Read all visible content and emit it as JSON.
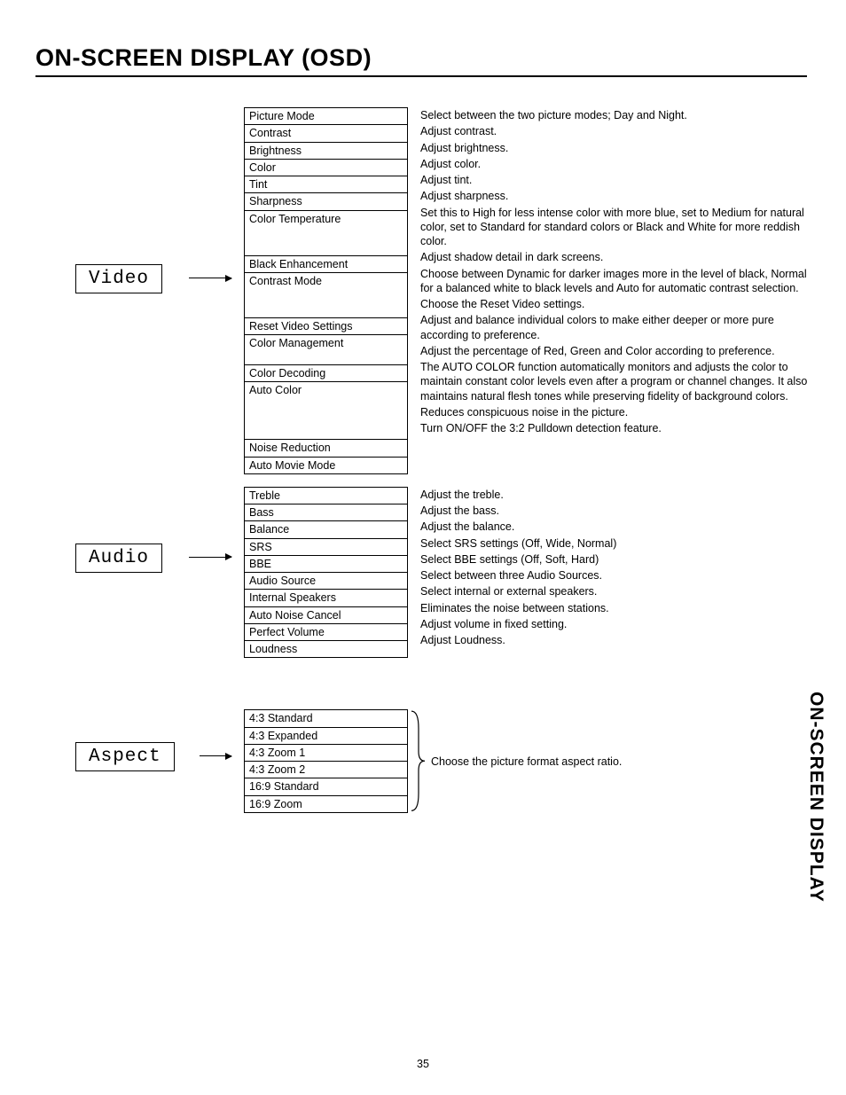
{
  "title": "ON-SCREEN DISPLAY (OSD)",
  "page_number": "35",
  "side_tab": "ON-SCREEN DISPLAY",
  "sections": {
    "video": {
      "label": "Video",
      "items": [
        {
          "name": "Picture Mode",
          "desc": "Select between the two picture modes; Day and Night."
        },
        {
          "name": "Contrast",
          "desc": "Adjust contrast."
        },
        {
          "name": "Brightness",
          "desc": "Adjust brightness."
        },
        {
          "name": "Color",
          "desc": "Adjust color."
        },
        {
          "name": "Tint",
          "desc": "Adjust tint."
        },
        {
          "name": "Sharpness",
          "desc": "Adjust sharpness."
        },
        {
          "name": "Color Temperature",
          "desc": "Set this to High for less intense color with more blue, set to Medium for natural color, set to Standard for standard colors or Black and White for more reddish color."
        },
        {
          "name": "Black Enhancement",
          "desc": "Adjust shadow detail in dark screens."
        },
        {
          "name": "Contrast Mode",
          "desc": "Choose between Dynamic for darker images more in the level of black, Normal for a balanced white to black levels and Auto for automatic contrast selection."
        },
        {
          "name": "Reset Video Settings",
          "desc": "Choose the Reset Video settings."
        },
        {
          "name": "Color Management",
          "desc": "Adjust and balance individual colors to make either deeper or more pure according to preference."
        },
        {
          "name": "Color Decoding",
          "desc": "Adjust the percentage of Red, Green and Color according to preference."
        },
        {
          "name": "Auto Color",
          "desc": "The AUTO COLOR function automatically monitors and adjusts the color to maintain constant color levels even after a program or channel changes. It also maintains natural flesh tones while preserving fidelity of background colors."
        },
        {
          "name": "Noise Reduction",
          "desc": "Reduces conspicuous noise in the picture."
        },
        {
          "name": "Auto Movie Mode",
          "desc": "Turn ON/OFF the 3:2 Pulldown detection feature."
        }
      ]
    },
    "audio": {
      "label": "Audio",
      "items": [
        {
          "name": "Treble",
          "desc": "Adjust the treble."
        },
        {
          "name": "Bass",
          "desc": "Adjust the bass."
        },
        {
          "name": "Balance",
          "desc": "Adjust the balance."
        },
        {
          "name": "SRS",
          "desc": "Select SRS settings (Off, Wide, Normal)"
        },
        {
          "name": "BBE",
          "desc": "Select BBE settings (Off, Soft, Hard)"
        },
        {
          "name": "Audio Source",
          "desc": "Select between three Audio Sources."
        },
        {
          "name": "Internal Speakers",
          "desc": "Select internal or external speakers."
        },
        {
          "name": "Auto Noise Cancel",
          "desc": "Eliminates the noise between stations."
        },
        {
          "name": "Perfect Volume",
          "desc": "Adjust volume in fixed setting."
        },
        {
          "name": "Loudness",
          "desc": "Adjust Loudness."
        }
      ]
    },
    "aspect": {
      "label": "Aspect",
      "desc": "Choose the picture format aspect ratio.",
      "items": [
        "4:3 Standard",
        "4:3 Expanded",
        "4:3 Zoom 1",
        "4:3 Zoom 2",
        "16:9 Standard",
        "16:9 Zoom"
      ]
    }
  }
}
